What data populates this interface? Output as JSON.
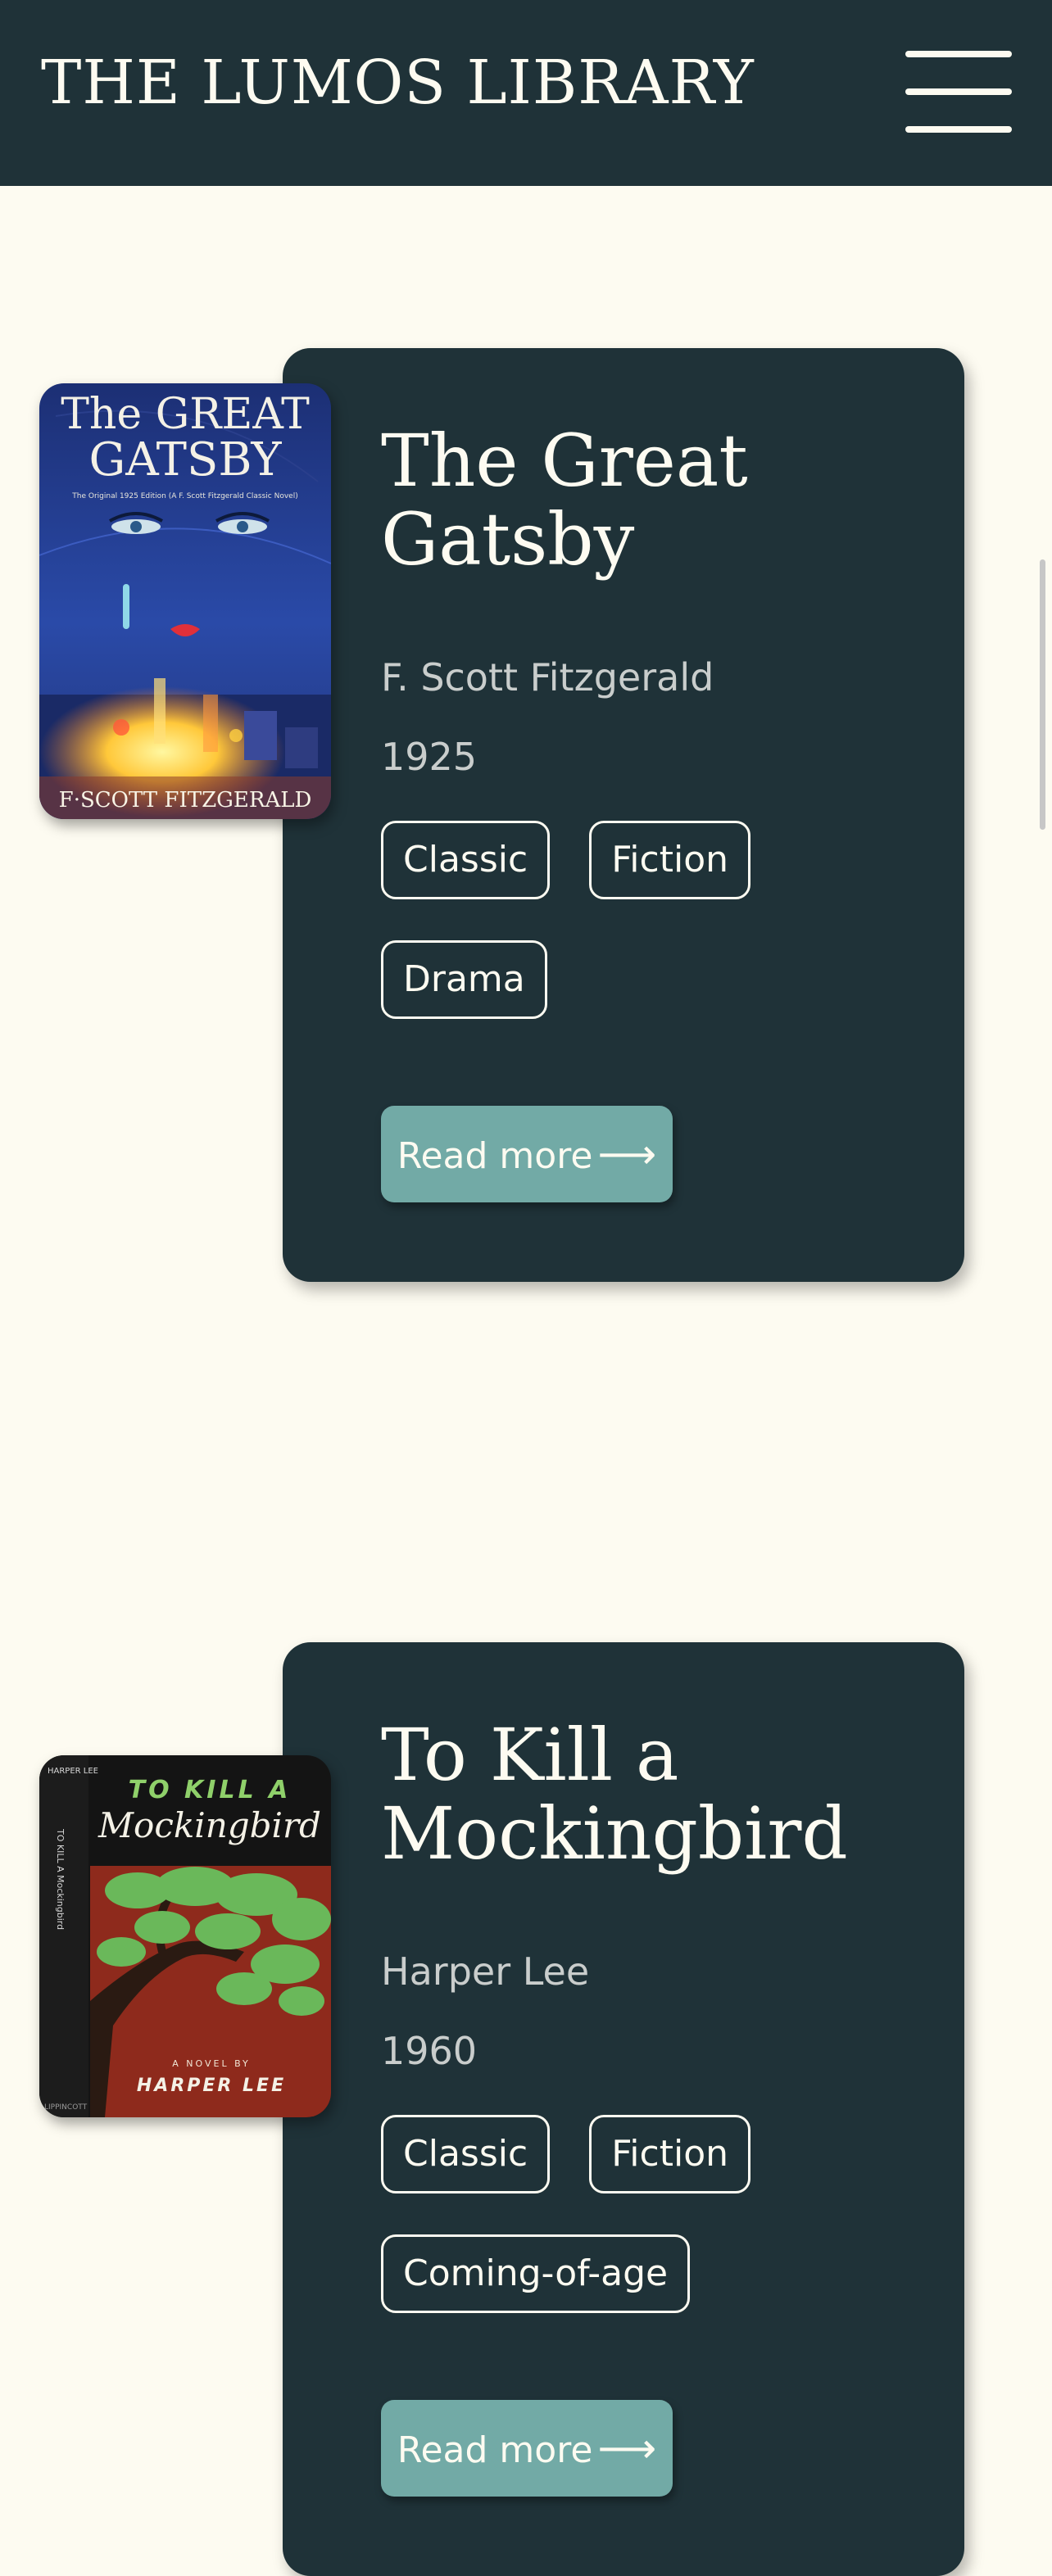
{
  "header": {
    "brand": "THE LUMOS LIBRARY",
    "menu_icon": "hamburger-menu-icon"
  },
  "colors": {
    "header_bg": "#1f3238",
    "page_bg": "#fdfbf1",
    "card_bg": "#1f3238",
    "button_bg": "#72aaa6",
    "muted_text": "#c9cdcc"
  },
  "books": [
    {
      "title": "The Great Gatsby",
      "author": "F. Scott Fitzgerald",
      "year": "1925",
      "tags": [
        "Classic",
        "Fiction",
        "Drama"
      ],
      "read_more": "Read more",
      "arrow_icon": "long-arrow-right-icon",
      "cover": {
        "title_line1": "The GREAT",
        "title_line2": "GATSBY",
        "edition_line": "The Original 1925 Edition (A F. Scott Fitzgerald Classic Novel)",
        "author_line": "F·SCOTT FITZGERALD"
      }
    },
    {
      "title": "To Kill a Mockingbird",
      "author": "Harper Lee",
      "year": "1960",
      "tags": [
        "Classic",
        "Fiction",
        "Coming-of-age"
      ],
      "read_more": "Read more",
      "arrow_icon": "long-arrow-right-icon",
      "cover": {
        "title_line1": "TO KILL A",
        "title_line2": "Mockingbird",
        "spine_text": "TO KILL A Mockingbird",
        "spine_top": "HARPER LEE",
        "spine_bottom": "LIPPINCOTT",
        "novel_by": "A NOVEL BY",
        "author_line": "HARPER LEE"
      }
    }
  ]
}
